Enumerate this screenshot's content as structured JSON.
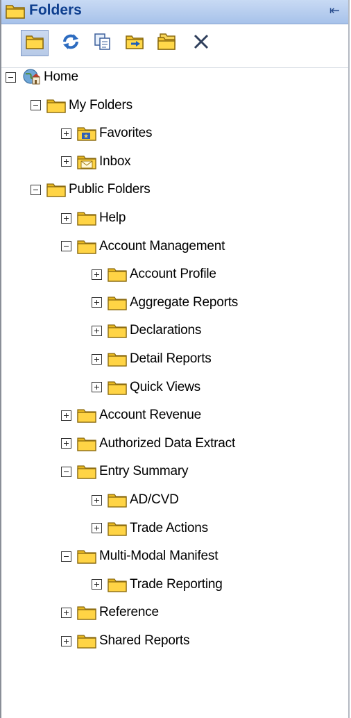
{
  "panel": {
    "title": "Folders",
    "pin_glyph": "⇤"
  },
  "toolbar": {
    "buttons": [
      {
        "name": "folder-view-button",
        "icon": "folder-icon"
      },
      {
        "name": "refresh-button",
        "icon": "refresh-icon"
      },
      {
        "name": "copy-button",
        "icon": "copy-document-icon"
      },
      {
        "name": "move-button",
        "icon": "move-folder-icon"
      },
      {
        "name": "new-folder-button",
        "icon": "new-folder-icon"
      },
      {
        "name": "delete-button",
        "icon": "close-icon"
      }
    ]
  },
  "tree": {
    "nodes": [
      {
        "label": "Home",
        "expanded": true,
        "icon": "home-globe-icon"
      },
      {
        "label": "My Folders",
        "expanded": true,
        "icon": "folder-icon"
      },
      {
        "label": "Favorites",
        "expanded": false,
        "icon": "favorites-folder-icon"
      },
      {
        "label": "Inbox",
        "expanded": false,
        "icon": "inbox-folder-icon"
      },
      {
        "label": "Public Folders",
        "expanded": true,
        "icon": "folder-icon"
      },
      {
        "label": "Help",
        "expanded": false,
        "icon": "folder-icon"
      },
      {
        "label": "Account Management",
        "expanded": true,
        "icon": "folder-icon"
      },
      {
        "label": "Account Profile",
        "expanded": false,
        "icon": "folder-icon"
      },
      {
        "label": "Aggregate Reports",
        "expanded": false,
        "icon": "folder-icon"
      },
      {
        "label": "Declarations",
        "expanded": false,
        "icon": "folder-icon"
      },
      {
        "label": "Detail Reports",
        "expanded": false,
        "icon": "folder-icon"
      },
      {
        "label": "Quick Views",
        "expanded": false,
        "icon": "folder-icon"
      },
      {
        "label": "Account Revenue",
        "expanded": false,
        "icon": "folder-icon"
      },
      {
        "label": "Authorized Data Extract",
        "expanded": false,
        "icon": "folder-icon"
      },
      {
        "label": "Entry Summary",
        "expanded": true,
        "icon": "folder-icon"
      },
      {
        "label": "AD/CVD",
        "expanded": false,
        "icon": "folder-icon"
      },
      {
        "label": "Trade Actions",
        "expanded": false,
        "icon": "folder-icon"
      },
      {
        "label": "Multi-Modal Manifest",
        "expanded": true,
        "icon": "folder-icon"
      },
      {
        "label": "Trade Reporting",
        "expanded": false,
        "icon": "folder-icon"
      },
      {
        "label": "Reference",
        "expanded": false,
        "icon": "folder-icon"
      },
      {
        "label": "Shared Reports",
        "expanded": false,
        "icon": "folder-icon"
      }
    ]
  }
}
